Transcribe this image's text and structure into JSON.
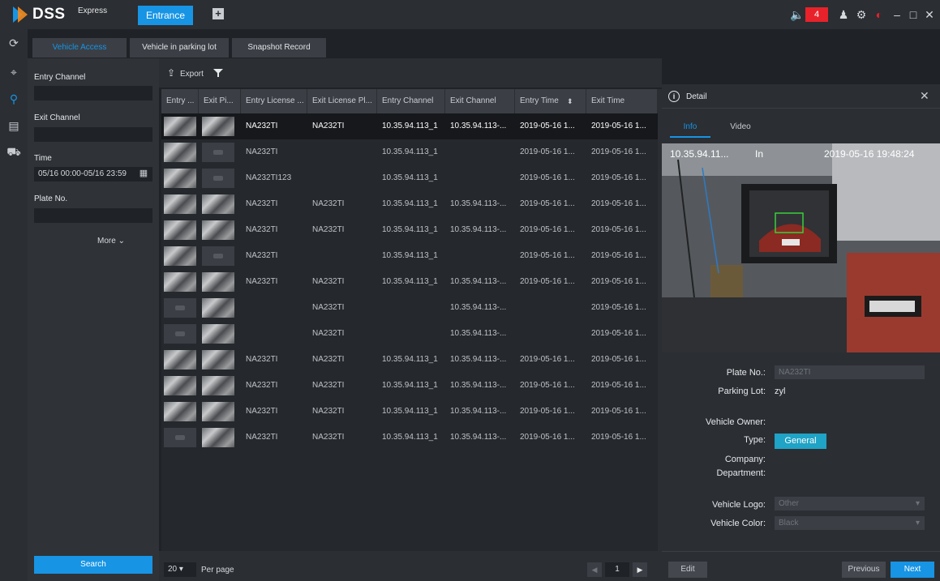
{
  "app": {
    "brand": "DSS",
    "brand_suffix": "Express",
    "module_tab": "Entrance",
    "add_tab": "+",
    "alarm_count": "4"
  },
  "titlebar_icons": [
    "volume-icon",
    "user-icon",
    "settings-icon",
    "speed-icon",
    "minimize-icon",
    "maximize-icon",
    "close-icon"
  ],
  "sidebar_icons": [
    "refresh-icon",
    "vehicle-capture-icon",
    "search-record-icon",
    "parking-icon",
    "car-icon"
  ],
  "tabs": [
    {
      "label": "Vehicle Access",
      "active": true
    },
    {
      "label": "Vehicle in parking lot",
      "active": false
    },
    {
      "label": "Snapshot Record",
      "active": false
    }
  ],
  "filter": {
    "entry_channel_label": "Entry Channel",
    "entry_channel_value": "",
    "exit_channel_label": "Exit Channel",
    "exit_channel_value": "",
    "time_label": "Time",
    "time_value": "05/16 00:00-05/16 23:59",
    "plate_label": "Plate No.",
    "plate_value": "",
    "more_label": "More",
    "search_label": "Search"
  },
  "toolbar": {
    "export_label": "Export"
  },
  "table": {
    "columns": [
      "Entry ...",
      "Exit Pi...",
      "Entry License ...",
      "Exit License Pl...",
      "Entry Channel",
      "Exit Channel",
      "Entry Time",
      "Exit Time"
    ],
    "rows": [
      {
        "entry_pic": true,
        "exit_pic": true,
        "entry_plate": "NA232TI",
        "exit_plate": "NA232TI",
        "entry_channel": "10.35.94.113_1",
        "exit_channel": "10.35.94.113-...",
        "entry_time": "2019-05-16 1...",
        "exit_time": "2019-05-16 1..."
      },
      {
        "entry_pic": true,
        "exit_pic": false,
        "entry_plate": "NA232TI",
        "exit_plate": "",
        "entry_channel": "10.35.94.113_1",
        "exit_channel": "",
        "entry_time": "2019-05-16 1...",
        "exit_time": "2019-05-16 1..."
      },
      {
        "entry_pic": true,
        "exit_pic": false,
        "entry_plate": "NA232TI123",
        "exit_plate": "",
        "entry_channel": "10.35.94.113_1",
        "exit_channel": "",
        "entry_time": "2019-05-16 1...",
        "exit_time": "2019-05-16 1..."
      },
      {
        "entry_pic": true,
        "exit_pic": true,
        "entry_plate": "NA232TI",
        "exit_plate": "NA232TI",
        "entry_channel": "10.35.94.113_1",
        "exit_channel": "10.35.94.113-...",
        "entry_time": "2019-05-16 1...",
        "exit_time": "2019-05-16 1..."
      },
      {
        "entry_pic": true,
        "exit_pic": true,
        "entry_plate": "NA232TI",
        "exit_plate": "NA232TI",
        "entry_channel": "10.35.94.113_1",
        "exit_channel": "10.35.94.113-...",
        "entry_time": "2019-05-16 1...",
        "exit_time": "2019-05-16 1..."
      },
      {
        "entry_pic": true,
        "exit_pic": false,
        "entry_plate": "NA232TI",
        "exit_plate": "",
        "entry_channel": "10.35.94.113_1",
        "exit_channel": "",
        "entry_time": "2019-05-16 1...",
        "exit_time": "2019-05-16 1..."
      },
      {
        "entry_pic": true,
        "exit_pic": true,
        "entry_plate": "NA232TI",
        "exit_plate": "NA232TI",
        "entry_channel": "10.35.94.113_1",
        "exit_channel": "10.35.94.113-...",
        "entry_time": "2019-05-16 1...",
        "exit_time": "2019-05-16 1..."
      },
      {
        "entry_pic": false,
        "exit_pic": true,
        "entry_plate": "",
        "exit_plate": "NA232TI",
        "entry_channel": "",
        "exit_channel": "10.35.94.113-...",
        "entry_time": "",
        "exit_time": "2019-05-16 1..."
      },
      {
        "entry_pic": false,
        "exit_pic": true,
        "entry_plate": "",
        "exit_plate": "NA232TI",
        "entry_channel": "",
        "exit_channel": "10.35.94.113-...",
        "entry_time": "",
        "exit_time": "2019-05-16 1..."
      },
      {
        "entry_pic": true,
        "exit_pic": true,
        "entry_plate": "NA232TI",
        "exit_plate": "NA232TI",
        "entry_channel": "10.35.94.113_1",
        "exit_channel": "10.35.94.113-...",
        "entry_time": "2019-05-16 1...",
        "exit_time": "2019-05-16 1..."
      },
      {
        "entry_pic": true,
        "exit_pic": true,
        "entry_plate": "NA232TI",
        "exit_plate": "NA232TI",
        "entry_channel": "10.35.94.113_1",
        "exit_channel": "10.35.94.113-...",
        "entry_time": "2019-05-16 1...",
        "exit_time": "2019-05-16 1..."
      },
      {
        "entry_pic": true,
        "exit_pic": true,
        "entry_plate": "NA232TI",
        "exit_plate": "NA232TI",
        "entry_channel": "10.35.94.113_1",
        "exit_channel": "10.35.94.113-...",
        "entry_time": "2019-05-16 1...",
        "exit_time": "2019-05-16 1..."
      },
      {
        "entry_pic": false,
        "exit_pic": true,
        "entry_plate": "NA232TI",
        "exit_plate": "NA232TI",
        "entry_channel": "10.35.94.113_1",
        "exit_channel": "10.35.94.113-...",
        "entry_time": "2019-05-16 1...",
        "exit_time": "2019-05-16 1..."
      }
    ]
  },
  "pagination": {
    "per_page_value": "20",
    "per_page_label": "Per page",
    "current_page": "1"
  },
  "detail": {
    "title": "Detail",
    "tabs": [
      "Info",
      "Video"
    ],
    "snapshot_channel": "10.35.94.11...",
    "snapshot_direction": "In",
    "snapshot_time": "2019-05-16 19:48:24",
    "plate_label": "Plate No.:",
    "plate_value": "NA232TI",
    "parking_lot_label": "Parking Lot:",
    "parking_lot_value": "zyl",
    "owner_label": "Vehicle Owner:",
    "owner_value": "",
    "type_label": "Type:",
    "type_value": "General",
    "company_label": "Company:",
    "company_value": "",
    "department_label": "Department:",
    "department_value": "",
    "logo_label": "Vehicle Logo:",
    "logo_value": "Other",
    "color_label": "Vehicle Color:",
    "color_value": "Black",
    "edit_label": "Edit",
    "prev_label": "Previous",
    "next_label": "Next"
  },
  "colors": {
    "accent": "#1794e4",
    "alarm": "#e8222a",
    "background": "#1f2226",
    "panel": "#2b2e33"
  }
}
